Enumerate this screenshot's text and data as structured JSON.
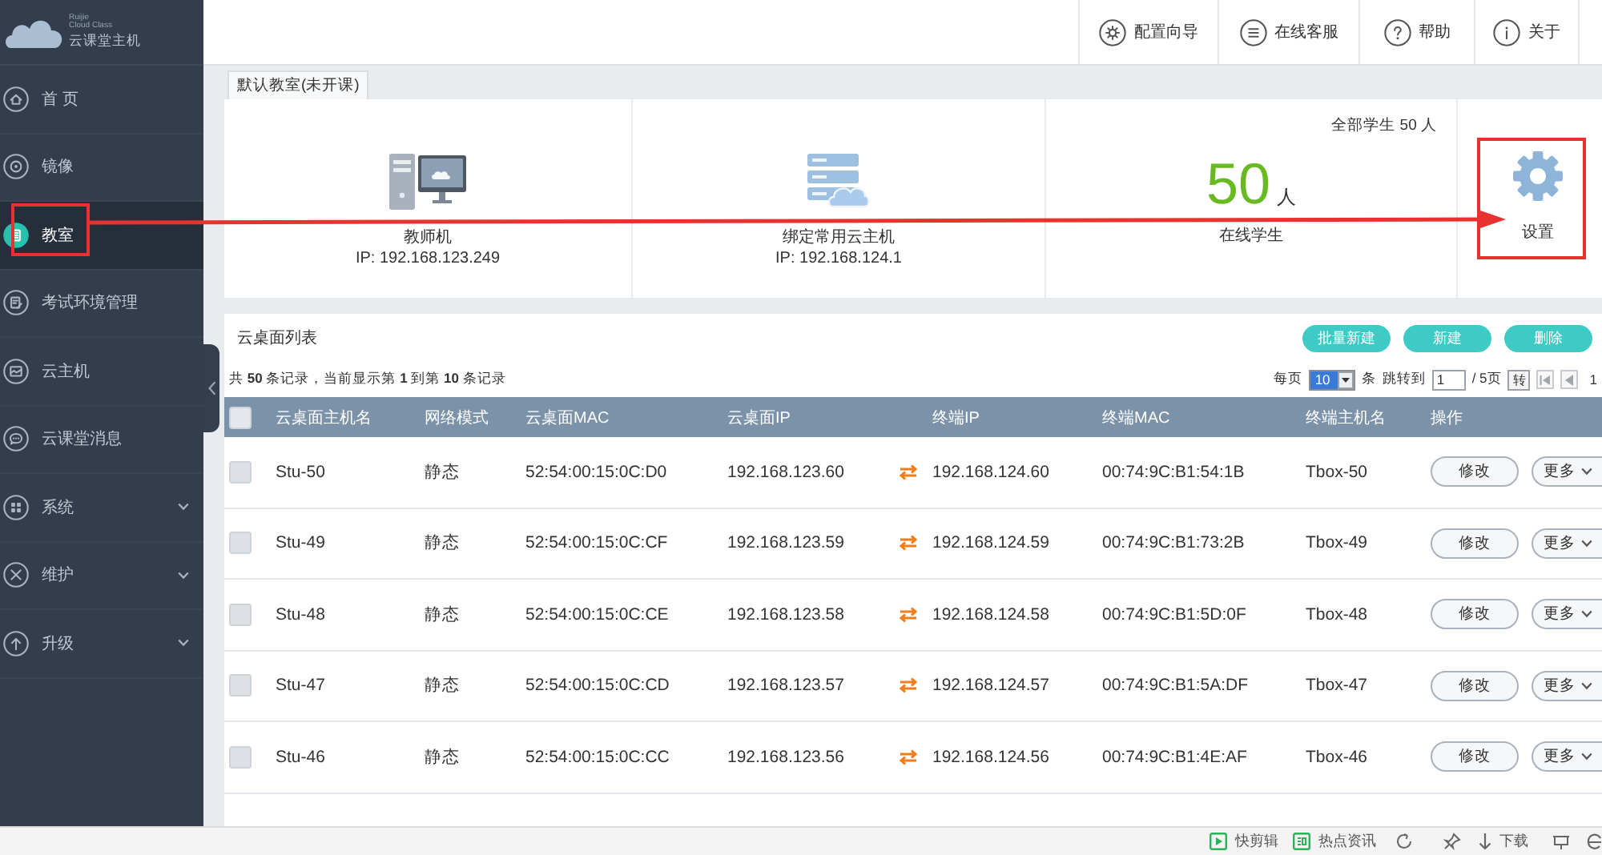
{
  "sidebar": {
    "logo": {
      "brand_lines": [
        "Ruijie",
        "Cloud Class"
      ],
      "title": "云课堂主机"
    },
    "items": [
      {
        "label": "首 页",
        "kind": "page",
        "selected": false
      },
      {
        "label": "镜像",
        "kind": "page",
        "selected": false
      },
      {
        "label": "教室",
        "kind": "page",
        "selected": true
      },
      {
        "label": "考试环境管理",
        "kind": "page",
        "selected": false
      },
      {
        "label": "云主机",
        "kind": "page",
        "selected": false
      },
      {
        "label": "云课堂消息",
        "kind": "page",
        "selected": false
      },
      {
        "label": "系统",
        "kind": "group",
        "selected": false
      },
      {
        "label": "维护",
        "kind": "group",
        "selected": false
      },
      {
        "label": "升级",
        "kind": "group",
        "selected": false
      }
    ]
  },
  "header": {
    "buttons": [
      {
        "label": "配置向导"
      },
      {
        "label": "在线客服"
      },
      {
        "label": "帮助"
      },
      {
        "label": "关于"
      }
    ]
  },
  "tabs": [
    {
      "label": "默认教室(未开课)",
      "selected": true
    }
  ],
  "summary": {
    "teacher": {
      "label": "教师机",
      "ip": "IP: 192.168.123.249"
    },
    "cloud_host": {
      "label": "绑定常用云主机",
      "ip": "IP: 192.168.124.1"
    },
    "students": {
      "total": "全部学生 50 人",
      "online_count": "50",
      "unit": "人",
      "label": "在线学生"
    },
    "settings": {
      "label": "设置"
    }
  },
  "desktop_list": {
    "title": "云桌面列表",
    "buttons": [
      {
        "label": "批量新建"
      },
      {
        "label": "新建"
      },
      {
        "label": "删除"
      }
    ],
    "record_info": "共 **50** 条记录，当前显示第 **1** 到第 **10** 条记录",
    "pagination": {
      "per_page_label": "每页",
      "per_page": "10",
      "per_page_unit": "条",
      "jump_label": "跳转到",
      "page_input": "1",
      "total_pages": "/ 5页",
      "go_button": "转",
      "current_page": "1"
    },
    "select_all": {
      "checked": false
    },
    "columns": [
      "云桌面主机名",
      "网络模式",
      "云桌面MAC",
      "云桌面IP",
      "终端IP",
      "终端MAC",
      "终端主机名",
      "操作"
    ],
    "rows": [
      {
        "checked": false,
        "host_name": "Stu-50",
        "network_mode": "静态",
        "desktop_mac": "52:54:00:15:0C:D0",
        "desktop_ip": "192.168.123.60",
        "terminal_ip": "192.168.124.60",
        "terminal_mac": "00:74:9C:B1:54:1B",
        "terminal_name": "Tbox-50",
        "actions": [
          "修改",
          "更多"
        ]
      },
      {
        "checked": false,
        "host_name": "Stu-49",
        "network_mode": "静态",
        "desktop_mac": "52:54:00:15:0C:CF",
        "desktop_ip": "192.168.123.59",
        "terminal_ip": "192.168.124.59",
        "terminal_mac": "00:74:9C:B1:73:2B",
        "terminal_name": "Tbox-49",
        "actions": [
          "修改",
          "更多"
        ]
      },
      {
        "checked": false,
        "host_name": "Stu-48",
        "network_mode": "静态",
        "desktop_mac": "52:54:00:15:0C:CE",
        "desktop_ip": "192.168.123.58",
        "terminal_ip": "192.168.124.58",
        "terminal_mac": "00:74:9C:B1:5D:0F",
        "terminal_name": "Tbox-48",
        "actions": [
          "修改",
          "更多"
        ]
      },
      {
        "checked": false,
        "host_name": "Stu-47",
        "network_mode": "静态",
        "desktop_mac": "52:54:00:15:0C:CD",
        "desktop_ip": "192.168.123.57",
        "terminal_ip": "192.168.124.57",
        "terminal_mac": "00:74:9C:B1:5A:DF",
        "terminal_name": "Tbox-47",
        "actions": [
          "修改",
          "更多"
        ]
      },
      {
        "checked": false,
        "host_name": "Stu-46",
        "network_mode": "静态",
        "desktop_mac": "52:54:00:15:0C:CC",
        "desktop_ip": "192.168.123.56",
        "terminal_ip": "192.168.124.56",
        "terminal_mac": "00:74:9C:B1:4E:AF",
        "terminal_name": "Tbox-46",
        "actions": [
          "修改",
          "更多"
        ]
      }
    ]
  },
  "status_bar": {
    "items": [
      {
        "label": "快剪辑"
      },
      {
        "label": "热点资讯"
      },
      {
        "label": "下载"
      }
    ]
  }
}
